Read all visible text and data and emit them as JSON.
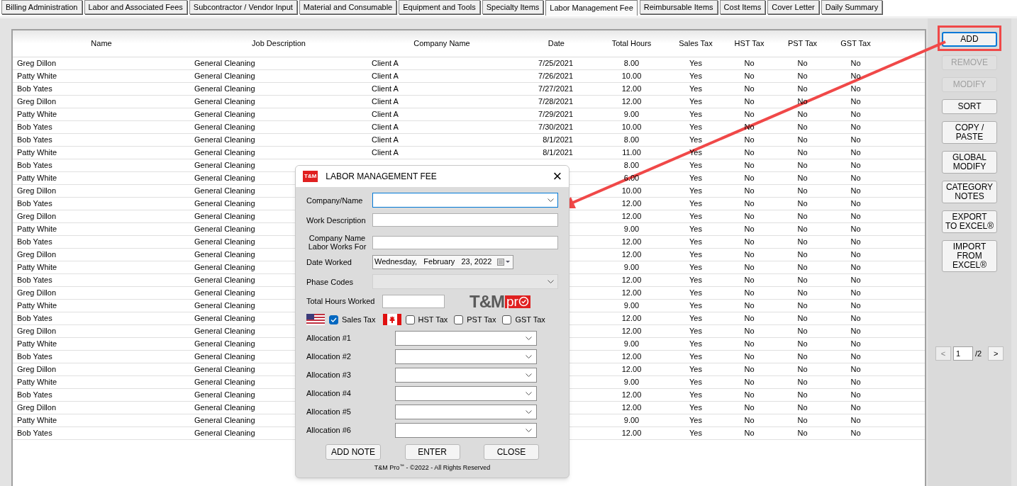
{
  "tabs": [
    {
      "label": "Billing Administration",
      "selected": false
    },
    {
      "label": "Labor and Associated Fees",
      "selected": false
    },
    {
      "label": "Subcontractor / Vendor Input",
      "selected": false
    },
    {
      "label": "Material and Consumable",
      "selected": false
    },
    {
      "label": "Equipment and Tools",
      "selected": false
    },
    {
      "label": "Specialty Items",
      "selected": false
    },
    {
      "label": "Labor Management Fee",
      "selected": true
    },
    {
      "label": "Reimbursable Items",
      "selected": false
    },
    {
      "label": "Cost Items",
      "selected": false
    },
    {
      "label": "Cover Letter",
      "selected": false
    },
    {
      "label": "Daily Summary",
      "selected": false
    }
  ],
  "table": {
    "columns": [
      "Name",
      "Job Description",
      "Company Name",
      "Date",
      "Total Hours",
      "Sales Tax",
      "HST Tax",
      "PST Tax",
      "GST Tax"
    ],
    "rows": [
      {
        "name": "Greg Dillon",
        "job_description": "General Cleaning",
        "company_name": "Client A",
        "date": "7/25/2021",
        "total_hours": "8.00",
        "sales_tax": "Yes",
        "hst_tax": "No",
        "pst_tax": "No",
        "gst_tax": "No"
      },
      {
        "name": "Patty White",
        "job_description": "General Cleaning",
        "company_name": "Client A",
        "date": "7/26/2021",
        "total_hours": "10.00",
        "sales_tax": "Yes",
        "hst_tax": "No",
        "pst_tax": "No",
        "gst_tax": "No"
      },
      {
        "name": "Bob Yates",
        "job_description": "General Cleaning",
        "company_name": "Client A",
        "date": "7/27/2021",
        "total_hours": "12.00",
        "sales_tax": "Yes",
        "hst_tax": "No",
        "pst_tax": "No",
        "gst_tax": "No"
      },
      {
        "name": "Greg Dillon",
        "job_description": "General Cleaning",
        "company_name": "Client A",
        "date": "7/28/2021",
        "total_hours": "12.00",
        "sales_tax": "Yes",
        "hst_tax": "No",
        "pst_tax": "No",
        "gst_tax": "No"
      },
      {
        "name": "Patty White",
        "job_description": "General Cleaning",
        "company_name": "Client A",
        "date": "7/29/2021",
        "total_hours": "9.00",
        "sales_tax": "Yes",
        "hst_tax": "No",
        "pst_tax": "No",
        "gst_tax": "No"
      },
      {
        "name": "Bob Yates",
        "job_description": "General Cleaning",
        "company_name": "Client A",
        "date": "7/30/2021",
        "total_hours": "10.00",
        "sales_tax": "Yes",
        "hst_tax": "No",
        "pst_tax": "No",
        "gst_tax": "No"
      },
      {
        "name": "Bob Yates",
        "job_description": "General Cleaning",
        "company_name": "Client A",
        "date": "8/1/2021",
        "total_hours": "8.00",
        "sales_tax": "Yes",
        "hst_tax": "No",
        "pst_tax": "No",
        "gst_tax": "No"
      },
      {
        "name": "Patty White",
        "job_description": "General Cleaning",
        "company_name": "Client A",
        "date": "8/1/2021",
        "total_hours": "11.00",
        "sales_tax": "Yes",
        "hst_tax": "No",
        "pst_tax": "No",
        "gst_tax": "No"
      },
      {
        "name": "Bob Yates",
        "job_description": "General Cleaning",
        "total_hours": "8.00",
        "sales_tax": "Yes",
        "hst_tax": "No",
        "pst_tax": "No",
        "gst_tax": "No"
      },
      {
        "name": "Patty White",
        "job_description": "General Cleaning",
        "total_hours": "6.00",
        "sales_tax": "Yes",
        "hst_tax": "No",
        "pst_tax": "No",
        "gst_tax": "No"
      },
      {
        "name": "Greg Dillon",
        "job_description": "General Cleaning",
        "total_hours": "10.00",
        "sales_tax": "Yes",
        "hst_tax": "No",
        "pst_tax": "No",
        "gst_tax": "No"
      },
      {
        "name": "Bob Yates",
        "job_description": "General Cleaning",
        "total_hours": "12.00",
        "sales_tax": "Yes",
        "hst_tax": "No",
        "pst_tax": "No",
        "gst_tax": "No"
      },
      {
        "name": "Greg Dillon",
        "job_description": "General Cleaning",
        "total_hours": "12.00",
        "sales_tax": "Yes",
        "hst_tax": "No",
        "pst_tax": "No",
        "gst_tax": "No"
      },
      {
        "name": "Patty White",
        "job_description": "General Cleaning",
        "total_hours": "9.00",
        "sales_tax": "Yes",
        "hst_tax": "No",
        "pst_tax": "No",
        "gst_tax": "No"
      },
      {
        "name": "Bob Yates",
        "job_description": "General Cleaning",
        "total_hours": "12.00",
        "sales_tax": "Yes",
        "hst_tax": "No",
        "pst_tax": "No",
        "gst_tax": "No"
      },
      {
        "name": "Greg Dillon",
        "job_description": "General Cleaning",
        "total_hours": "12.00",
        "sales_tax": "Yes",
        "hst_tax": "No",
        "pst_tax": "No",
        "gst_tax": "No"
      },
      {
        "name": "Patty White",
        "job_description": "General Cleaning",
        "total_hours": "9.00",
        "sales_tax": "Yes",
        "hst_tax": "No",
        "pst_tax": "No",
        "gst_tax": "No"
      },
      {
        "name": "Bob Yates",
        "job_description": "General Cleaning",
        "total_hours": "12.00",
        "sales_tax": "Yes",
        "hst_tax": "No",
        "pst_tax": "No",
        "gst_tax": "No"
      },
      {
        "name": "Greg Dillon",
        "job_description": "General Cleaning",
        "total_hours": "12.00",
        "sales_tax": "Yes",
        "hst_tax": "No",
        "pst_tax": "No",
        "gst_tax": "No"
      },
      {
        "name": "Patty White",
        "job_description": "General Cleaning",
        "total_hours": "9.00",
        "sales_tax": "Yes",
        "hst_tax": "No",
        "pst_tax": "No",
        "gst_tax": "No"
      },
      {
        "name": "Bob Yates",
        "job_description": "General Cleaning",
        "total_hours": "12.00",
        "sales_tax": "Yes",
        "hst_tax": "No",
        "pst_tax": "No",
        "gst_tax": "No"
      },
      {
        "name": "Greg Dillon",
        "job_description": "General Cleaning",
        "total_hours": "12.00",
        "sales_tax": "Yes",
        "hst_tax": "No",
        "pst_tax": "No",
        "gst_tax": "No"
      },
      {
        "name": "Patty White",
        "job_description": "General Cleaning",
        "total_hours": "9.00",
        "sales_tax": "Yes",
        "hst_tax": "No",
        "pst_tax": "No",
        "gst_tax": "No"
      },
      {
        "name": "Bob Yates",
        "job_description": "General Cleaning",
        "total_hours": "12.00",
        "sales_tax": "Yes",
        "hst_tax": "No",
        "pst_tax": "No",
        "gst_tax": "No"
      },
      {
        "name": "Greg Dillon",
        "job_description": "General Cleaning",
        "total_hours": "12.00",
        "sales_tax": "Yes",
        "hst_tax": "No",
        "pst_tax": "No",
        "gst_tax": "No"
      },
      {
        "name": "Patty White",
        "job_description": "General Cleaning",
        "total_hours": "9.00",
        "sales_tax": "Yes",
        "hst_tax": "No",
        "pst_tax": "No",
        "gst_tax": "No"
      },
      {
        "name": "Bob Yates",
        "job_description": "General Cleaning",
        "total_hours": "12.00",
        "sales_tax": "Yes",
        "hst_tax": "No",
        "pst_tax": "No",
        "gst_tax": "No"
      },
      {
        "name": "Greg Dillon",
        "job_description": "General Cleaning",
        "total_hours": "12.00",
        "sales_tax": "Yes",
        "hst_tax": "No",
        "pst_tax": "No",
        "gst_tax": "No"
      },
      {
        "name": "Patty White",
        "job_description": "General Cleaning",
        "total_hours": "9.00",
        "sales_tax": "Yes",
        "hst_tax": "No",
        "pst_tax": "No",
        "gst_tax": "No"
      },
      {
        "name": "Bob Yates",
        "job_description": "General Cleaning",
        "total_hours": "12.00",
        "sales_tax": "Yes",
        "hst_tax": "No",
        "pst_tax": "No",
        "gst_tax": "No"
      }
    ]
  },
  "side_buttons": [
    {
      "label": "ADD",
      "disabled": false,
      "highlighted": true
    },
    {
      "label": "REMOVE",
      "disabled": true,
      "highlighted": false
    },
    {
      "label": "MODIFY",
      "disabled": true,
      "highlighted": false
    },
    {
      "label": "SORT",
      "disabled": false,
      "highlighted": false
    },
    {
      "label": "COPY / PASTE",
      "disabled": false,
      "highlighted": false
    },
    {
      "label": "GLOBAL MODIFY",
      "disabled": false,
      "highlighted": false
    },
    {
      "label": "CATEGORY NOTES",
      "disabled": false,
      "highlighted": false
    },
    {
      "label": "EXPORT TO EXCEL®",
      "disabled": false,
      "highlighted": false
    },
    {
      "label": "IMPORT FROM EXCEL®",
      "disabled": false,
      "highlighted": false
    }
  ],
  "pager": {
    "prev": "<",
    "page": "1",
    "total": "/2",
    "next": ">"
  },
  "dialog": {
    "app_icon": "T&M",
    "title": "LABOR MANAGEMENT FEE",
    "close": "×",
    "fields": [
      {
        "label": "Company/Name",
        "kind": "combo",
        "focused": true,
        "disabled": false
      },
      {
        "label": "Work Description",
        "kind": "text"
      },
      {
        "label": "Company Name\nLabor Works For",
        "kind": "text"
      },
      {
        "label": "Date Worked",
        "kind": "date",
        "value": "Wednesday,   February   23, 2022"
      },
      {
        "label": "Phase Codes",
        "kind": "combo",
        "focused": false,
        "disabled": true
      },
      {
        "label": "Total Hours Worked",
        "kind": "short"
      }
    ],
    "logo": {
      "main": "T&M",
      "accent": "pr"
    },
    "taxes": [
      {
        "label": "Sales Tax",
        "checked": true,
        "kind": "striped_flag"
      },
      {
        "label": "HST Tax",
        "checked": false,
        "kind": "leaf_flag"
      },
      {
        "label": "PST Tax",
        "checked": false,
        "kind": "plain"
      },
      {
        "label": "GST Tax",
        "checked": false,
        "kind": "plain"
      }
    ],
    "allocations": [
      "Allocation #1",
      "Allocation #2",
      "Allocation #3",
      "Allocation #4",
      "Allocation #5",
      "Allocation #6"
    ],
    "buttons": [
      "ADD NOTE",
      "ENTER",
      "CLOSE"
    ],
    "footer": "T&M Pro$^{™}$ - ©2022 - All Rights Reserved"
  }
}
